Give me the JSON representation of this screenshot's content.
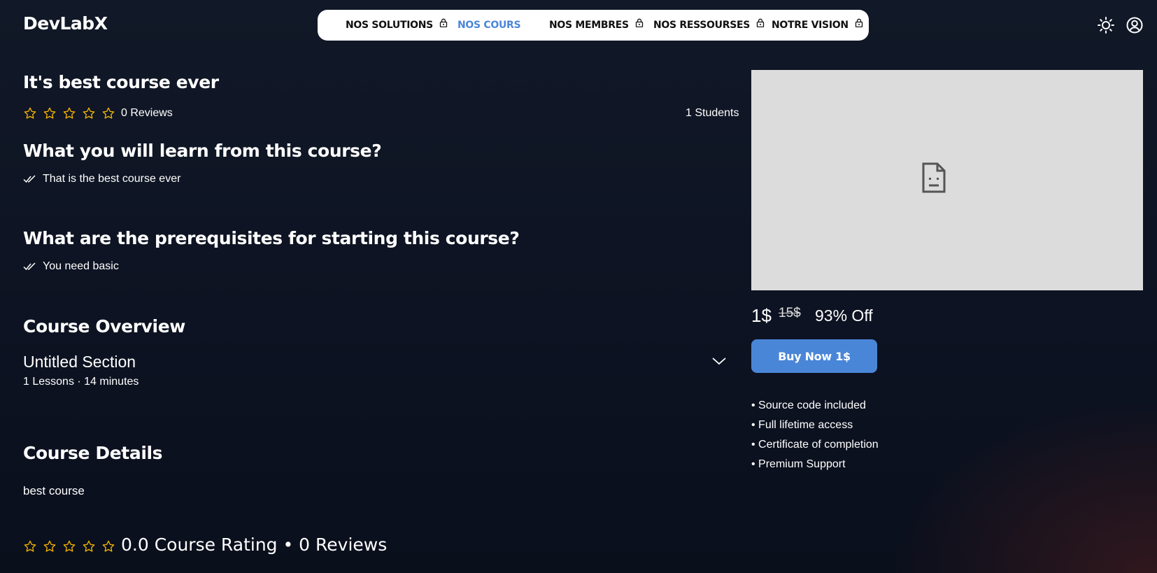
{
  "app": {
    "logo": "DevLabX"
  },
  "nav": {
    "items": [
      {
        "label": "NOS SOLUTIONS",
        "locked": true,
        "active": false
      },
      {
        "label": "NOS COURS",
        "locked": false,
        "active": true
      },
      {
        "label": "NOS MEMBRES",
        "locked": true,
        "active": false
      },
      {
        "label": "NOS RESSOURSES",
        "locked": true,
        "active": false
      },
      {
        "label": "NOTRE VISION",
        "locked": true,
        "active": false
      }
    ]
  },
  "header_icons": [
    "sun-icon",
    "user-circle-icon"
  ],
  "course": {
    "title": "It's best course ever",
    "rating_stars": 0,
    "reviews_label": "0 Reviews",
    "students_label": "1 Students",
    "learn_heading": "What you will learn from this course?",
    "learn_items": [
      "That is the best course ever"
    ],
    "prereq_heading": "What are the prerequisites for starting this course?",
    "prereq_items": [
      "You need basic"
    ],
    "overview_heading": "Course Overview",
    "sections": [
      {
        "title": "Untitled Section",
        "meta": "1 Lessons · 14 minutes"
      }
    ],
    "details_heading": "Course Details",
    "details_text": "best course",
    "rating_summary": "0.0 Course Rating • 0 Reviews"
  },
  "purchase": {
    "price": "1$",
    "old_price": "15$",
    "discount": "93% Off",
    "buy_label": "Buy Now 1$",
    "features": [
      "• Source code included",
      "• Full lifetime access",
      "• Certificate of completion",
      "• Premium Support"
    ]
  },
  "colors": {
    "accent": "#4a86d8",
    "star": "#f5b400",
    "background": "#0d1322",
    "nav_bg": "#ffffff",
    "video_placeholder": "#dcdcdc"
  }
}
